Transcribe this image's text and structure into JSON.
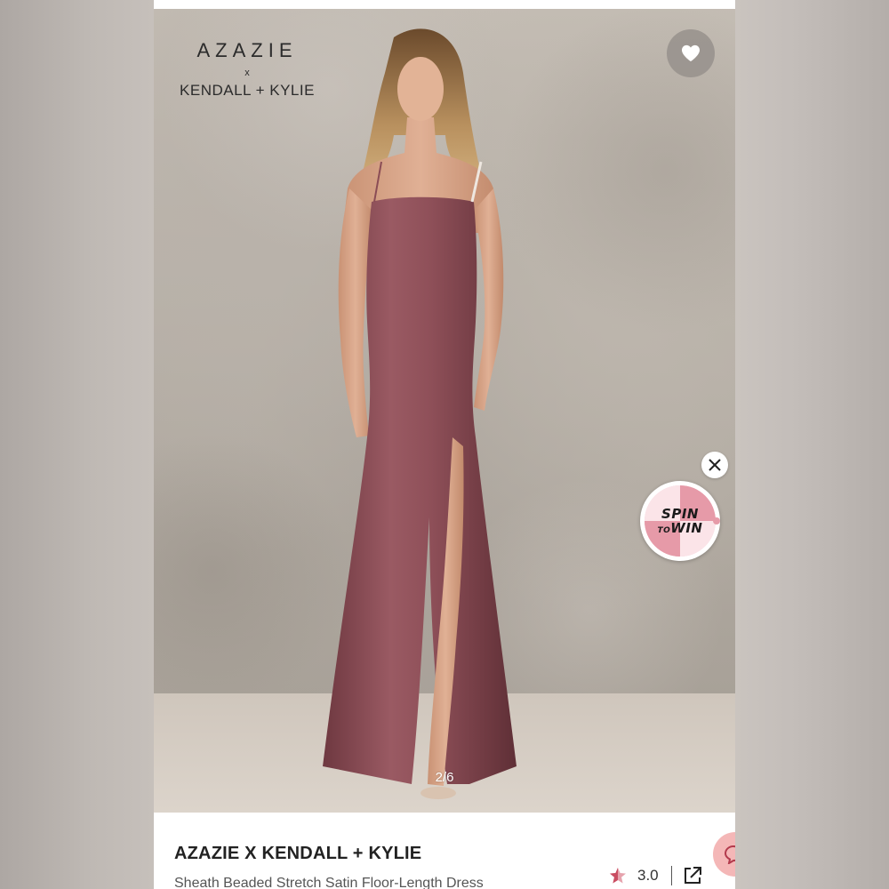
{
  "brand_logo": {
    "main": "AZAZIE",
    "x": "x",
    "sub": "KENDALL + KYLIE"
  },
  "gallery": {
    "counter": "2/6",
    "favorite_icon": "heart-icon",
    "dress_color": "#8c4e57"
  },
  "promo": {
    "close_icon": "close-icon",
    "line1": "SPIN",
    "line2_small": "TO",
    "line2": "WIN",
    "accent": "#e69aa8"
  },
  "product": {
    "brand": "AZAZIE X KENDALL + KYLIE",
    "title": "Sheath Beaded Stretch Satin Floor-Length Dress",
    "rating": "3.0",
    "rating_icon": "star-icon",
    "share_icon": "share-icon",
    "chat_icon": "chat-icon"
  }
}
